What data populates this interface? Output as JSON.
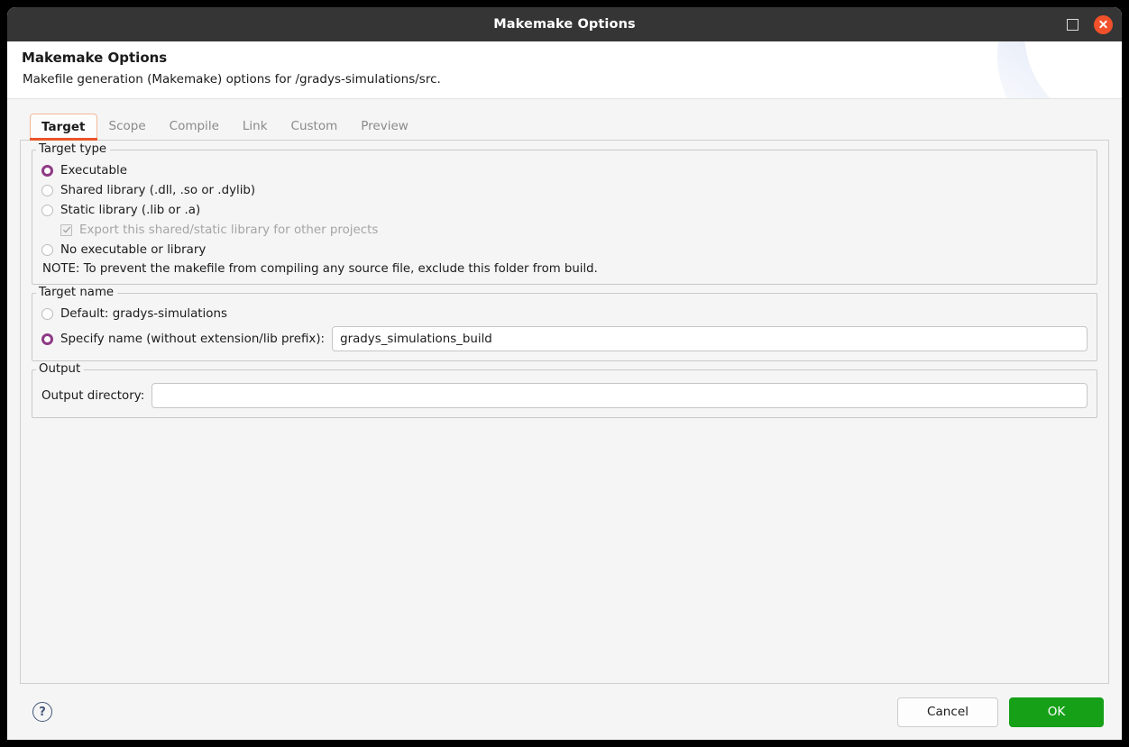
{
  "window": {
    "title": "Makemake Options",
    "maximize_icon": "maximize-square-icon",
    "close_icon": "close-x-icon"
  },
  "header": {
    "title": "Makemake Options",
    "subtitle": "Makefile generation (Makemake) options for /gradys-simulations/src."
  },
  "tabs": [
    {
      "label": "Target",
      "active": true
    },
    {
      "label": "Scope",
      "active": false
    },
    {
      "label": "Compile",
      "active": false
    },
    {
      "label": "Link",
      "active": false
    },
    {
      "label": "Custom",
      "active": false
    },
    {
      "label": "Preview",
      "active": false
    }
  ],
  "target_type": {
    "legend": "Target type",
    "options": [
      {
        "label": "Executable",
        "selected": true,
        "disabled": false
      },
      {
        "label": "Shared library (.dll, .so or .dylib)",
        "selected": false,
        "disabled": false
      },
      {
        "label": "Static library (.lib or .a)",
        "selected": false,
        "disabled": false
      },
      {
        "label": "No executable or library",
        "selected": false,
        "disabled": false
      }
    ],
    "export_checkbox": {
      "label": "Export this shared/static library for other projects",
      "checked": true,
      "disabled": true
    },
    "note": "NOTE: To prevent the makefile from compiling any source file, exclude this folder from build."
  },
  "target_name": {
    "legend": "Target name",
    "default_option": {
      "label": "Default: gradys-simulations",
      "selected": false
    },
    "specify_option": {
      "label": "Specify name (without extension/lib prefix):",
      "selected": true
    },
    "name_value": "gradys_simulations_build",
    "name_placeholder": ""
  },
  "output": {
    "legend": "Output",
    "directory_label": "Output directory:",
    "directory_value": "",
    "directory_placeholder": ""
  },
  "footer": {
    "help_icon": "help-question-icon",
    "cancel_label": "Cancel",
    "ok_label": "OK"
  },
  "colors": {
    "accent_orange": "#e8562a",
    "radio_selected": "#8e3a86",
    "ok_green": "#16a018",
    "close_red": "#f1512a",
    "titlebar_bg": "#353535"
  }
}
